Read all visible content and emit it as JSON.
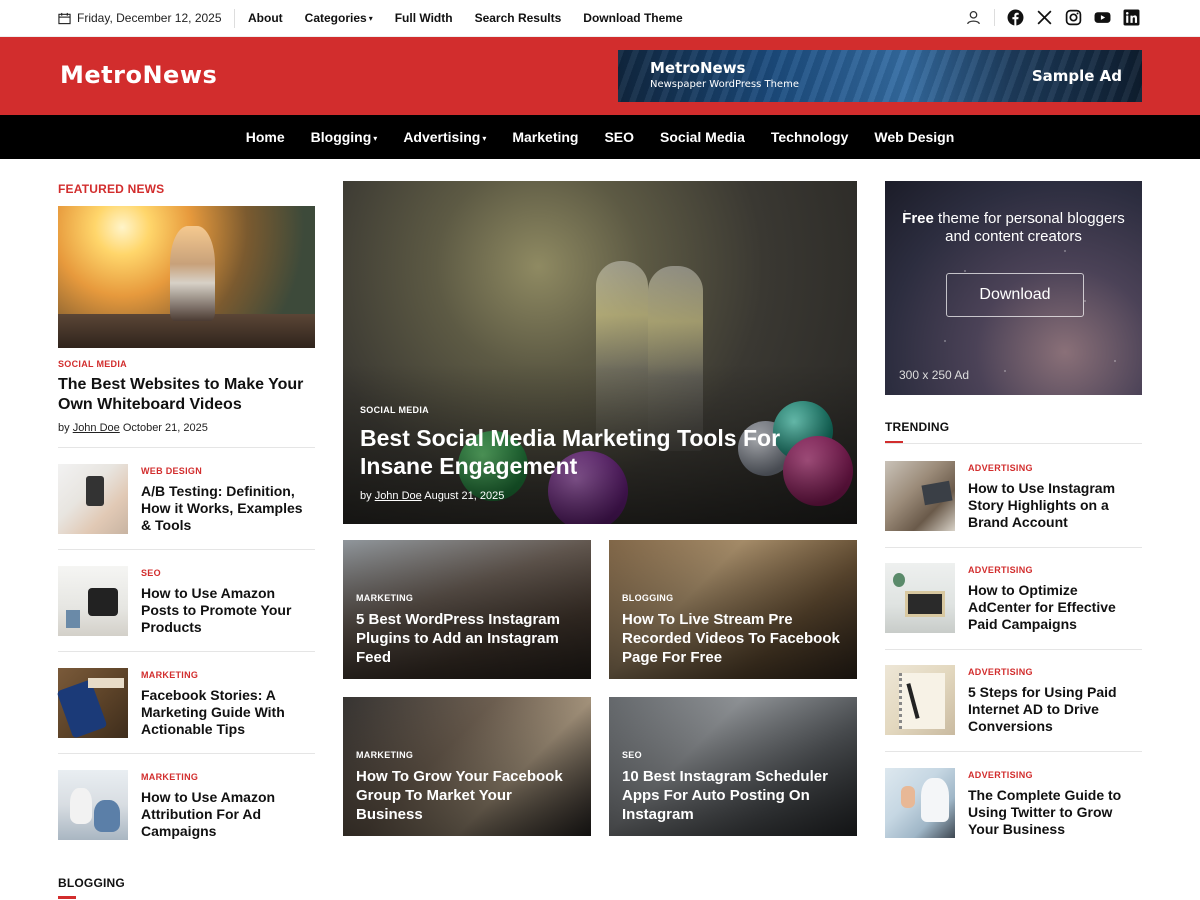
{
  "topbar": {
    "date": "Friday, December 12, 2025",
    "nav": [
      "About",
      "Categories",
      "Full Width",
      "Search Results",
      "Download Theme"
    ],
    "icons": [
      "user-icon",
      "facebook-icon",
      "x-icon",
      "instagram-icon",
      "youtube-icon",
      "linkedin-icon"
    ]
  },
  "header": {
    "logo": "MetroNews",
    "ad": {
      "title": "MetroNews",
      "subtitle": "Newspaper WordPress Theme",
      "tag": "Sample Ad"
    }
  },
  "mainnav": [
    "Home",
    "Blogging",
    "Advertising",
    "Marketing",
    "SEO",
    "Social Media",
    "Technology",
    "Web Design"
  ],
  "featured": {
    "label": "FEATURED NEWS",
    "main": {
      "category": "SOCIAL MEDIA",
      "title": "The Best Websites to Make Your Own Whiteboard Videos",
      "by": "by",
      "author": "John Doe",
      "date": "October 21, 2025"
    },
    "list": [
      {
        "category": "WEB DESIGN",
        "title": "A/B Testing: Definition, How it Works, Examples & Tools"
      },
      {
        "category": "SEO",
        "title": "How to Use Amazon Posts to Promote Your Products"
      },
      {
        "category": "MARKETING",
        "title": "Facebook Stories: A Marketing Guide With Actionable Tips"
      },
      {
        "category": "MARKETING",
        "title": "How to Use Amazon Attribution For Ad Campaigns"
      }
    ]
  },
  "hero": {
    "category": "SOCIAL MEDIA",
    "title": "Best Social Media Marketing Tools For Insane Engagement",
    "by": "by",
    "author": "John Doe",
    "date": "August 21, 2025"
  },
  "cards": [
    {
      "category": "MARKETING",
      "title": "5 Best WordPress Instagram Plugins to Add an Instagram Feed"
    },
    {
      "category": "BLOGGING",
      "title": "How To Live Stream Pre Recorded Videos To Facebook Page For Free"
    },
    {
      "category": "MARKETING",
      "title": "How To Grow Your Facebook Group To Market Your Business"
    },
    {
      "category": "SEO",
      "title": "10 Best Instagram Scheduler Apps For Auto Posting On Instagram"
    }
  ],
  "side_ad": {
    "bold": "Free",
    "text_line1": "theme for personal bloggers",
    "text_line2": "and content creators",
    "button": "Download",
    "size": "300 x 250 Ad"
  },
  "trending": {
    "label": "TRENDING",
    "items": [
      {
        "category": "ADVERTISING",
        "title": "How to Use Instagram Story Highlights on a Brand Account"
      },
      {
        "category": "ADVERTISING",
        "title": "How to Optimize AdCenter for Effective Paid Campaigns"
      },
      {
        "category": "ADVERTISING",
        "title": "5 Steps for Using Paid Internet AD to Drive Conversions"
      },
      {
        "category": "ADVERTISING",
        "title": "The Complete Guide to Using Twitter to Grow Your Business"
      }
    ]
  },
  "blogging": {
    "label": "BLOGGING"
  },
  "colors": {
    "brand_red": "#d22d2d",
    "nav_black": "#000000"
  }
}
